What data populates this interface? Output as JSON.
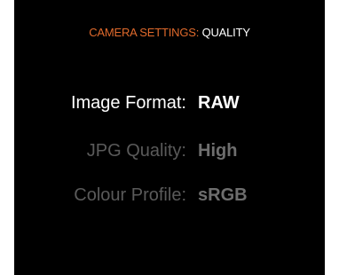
{
  "header": {
    "category": "CAMERA SETTINGS",
    "separator": ":",
    "page": "QUALITY"
  },
  "settings": [
    {
      "label": "Image Format:",
      "value": "RAW",
      "selected": true
    },
    {
      "label": "JPG Quality:",
      "value": "High",
      "selected": false
    },
    {
      "label": "Colour Profile:",
      "value": "sRGB",
      "selected": false
    }
  ],
  "colors": {
    "background": "#000000",
    "accent": "#e06a2c",
    "active_text": "#ffffff",
    "inactive_text": "#5a5a5a"
  }
}
